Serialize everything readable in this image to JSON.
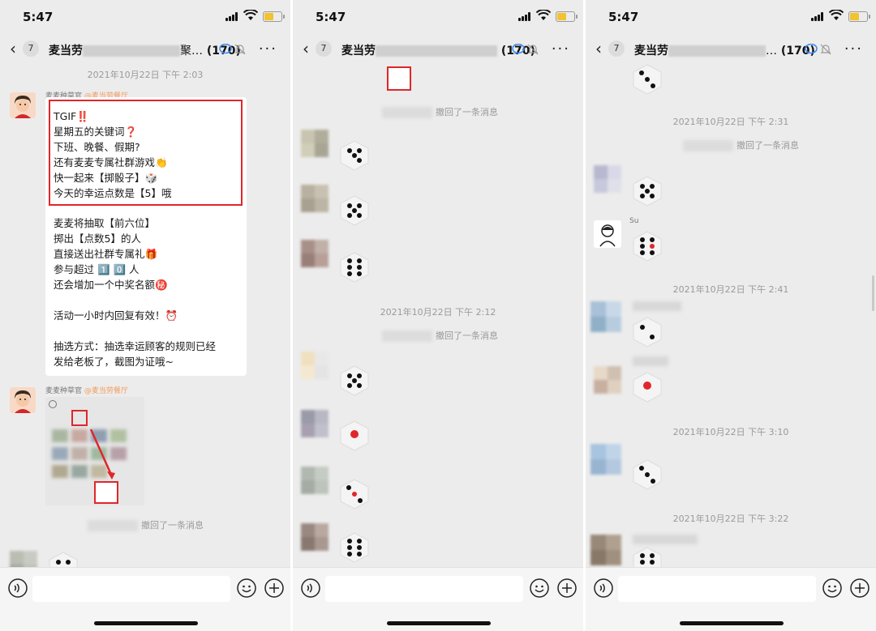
{
  "status_bar": {
    "time": "5:47"
  },
  "header": {
    "back_glyph": "‹",
    "unread_count": "7",
    "group_name_visible": "麦当劳",
    "member_count": "(170)",
    "more_glyph": "···"
  },
  "panels": [
    {
      "timestamps": [
        "2021年10月22日 下午 2:03"
      ],
      "recalled": [
        "撤回了一条消息"
      ],
      "messages": [
        {
          "sender": "麦麦种草官",
          "at": "@麦当劳餐厅",
          "highlight_lines": [
            "TGIF‼️",
            "星期五的关键词❓",
            "下班、晚餐、假期?",
            "还有麦麦专属社群游戏👏",
            "快一起来【掷骰子】🎲",
            "今天的幸运点数是【5】哦"
          ],
          "lines": [
            "麦麦将抽取【前六位】",
            "掷出【点数5】的人",
            "直接送出社群专属礼🎁",
            "参与超过 1️⃣ 0️⃣ 人",
            "还会增加一个中奖名额㊙️",
            "",
            "活动一小时内回复有效！⏰",
            "",
            "抽选方式：抽选幸运顾客的规则已经",
            "发给老板了，截图为证哦~"
          ]
        },
        {
          "sender": "麦麦种草官",
          "at": "@麦当劳餐厅"
        }
      ]
    },
    {
      "timestamps": [
        "2021年10月22日 下午 2:12"
      ],
      "recalled": [
        "撤回了一条消息",
        "撤回了一条消息"
      ]
    },
    {
      "timestamps": [
        "2021年10月22日 下午 2:31",
        "2021年10月22日 下午 2:41",
        "2021年10月22日 下午 3:10",
        "2021年10月22日 下午 3:22"
      ],
      "recalled": [
        "撤回了一条消息"
      ],
      "sender_su": "Su"
    }
  ],
  "colors": {
    "highlight": "#e0262a",
    "background": "#ececec",
    "bubble": "#ffffff",
    "mention": "#f39a5a"
  }
}
